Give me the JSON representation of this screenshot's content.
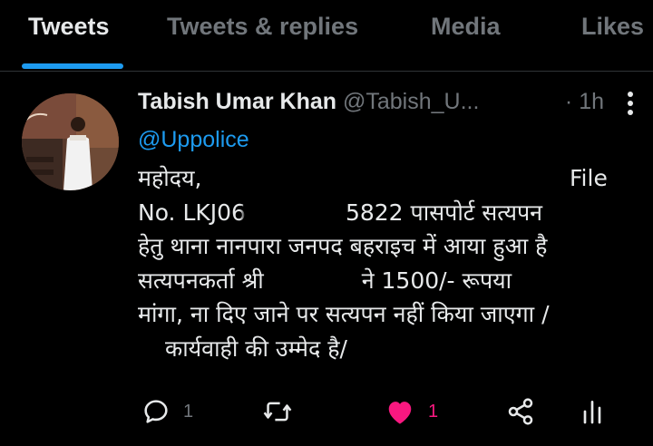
{
  "tabs": [
    {
      "label": "Tweets",
      "active": true
    },
    {
      "label": "Tweets & replies",
      "active": false
    },
    {
      "label": "Media",
      "active": false
    },
    {
      "label": "Likes",
      "active": false
    }
  ],
  "tweet": {
    "author_name": "Tabish Umar Khan",
    "author_handle": "@Tabish_U...",
    "separator": "·",
    "time": "1h",
    "mention": "@Uppolice",
    "lines": {
      "l1_left": "महोदय,",
      "l1_right": "File",
      "l2_a": "No. LKJ06",
      "l2_b": "5822 पासपोर्ट सत्यपन",
      "l3": "हेतु थाना नानपारा जनपद बहराइच में आया हुआ है",
      "l4_a": "सत्यपनकर्ता श्री",
      "l4_b": "ने   1500/- रूपया",
      "l5": "मांगा, ना दिए जाने पर सत्यपन नहीं किया जाएगा /",
      "l6": "कार्यवाही की उम्मेद है/"
    },
    "reply_count": "1",
    "retweet_count": "",
    "like_count": "1"
  },
  "icons": {
    "reply": "reply-icon",
    "retweet": "retweet-icon",
    "like": "heart-icon",
    "share": "share-icon",
    "analytics": "analytics-icon",
    "more": "more-icon"
  },
  "colors": {
    "background": "#000000",
    "accent": "#1d9bf0",
    "muted": "#71767b",
    "like": "#f91880"
  }
}
